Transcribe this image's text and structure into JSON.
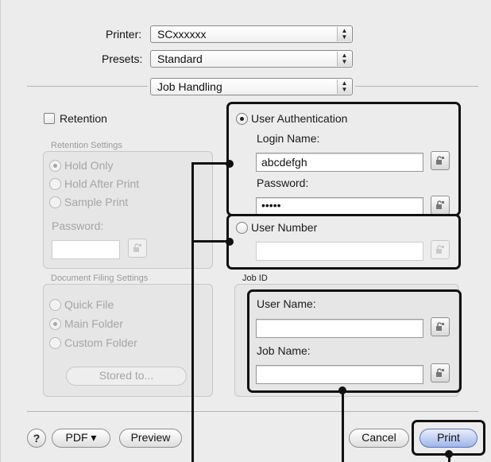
{
  "printer": {
    "label": "Printer:",
    "value": "SCxxxxxx"
  },
  "presets": {
    "label": "Presets:",
    "value": "Standard"
  },
  "panel": {
    "value": "Job Handling"
  },
  "retention": {
    "checkbox_label": "Retention",
    "checked": false,
    "group_title": "Retention Settings",
    "options": [
      "Hold Only",
      "Hold After Print",
      "Sample Print"
    ],
    "selected": "Hold Only",
    "password_label": "Password:",
    "password_value": ""
  },
  "document_filing": {
    "group_title": "Document Filing Settings",
    "options": [
      "Quick File",
      "Main Folder",
      "Custom Folder"
    ],
    "selected": "Main Folder",
    "stored_to_label": "Stored to..."
  },
  "authentication": {
    "user_auth_label": "User Authentication",
    "selected": "User Authentication",
    "login_name_label": "Login Name:",
    "login_name_value": "abcdefgh",
    "password_label": "Password:",
    "password_value": "•••••",
    "user_number_label": "User Number",
    "user_number_value": ""
  },
  "job_id": {
    "group_title": "Job ID",
    "user_name_label": "User Name:",
    "user_name_value": "",
    "job_name_label": "Job Name:",
    "job_name_value": ""
  },
  "footer": {
    "help_label": "?",
    "pdf_label": "PDF ▾",
    "preview_label": "Preview",
    "cancel_label": "Cancel",
    "print_label": "Print"
  }
}
